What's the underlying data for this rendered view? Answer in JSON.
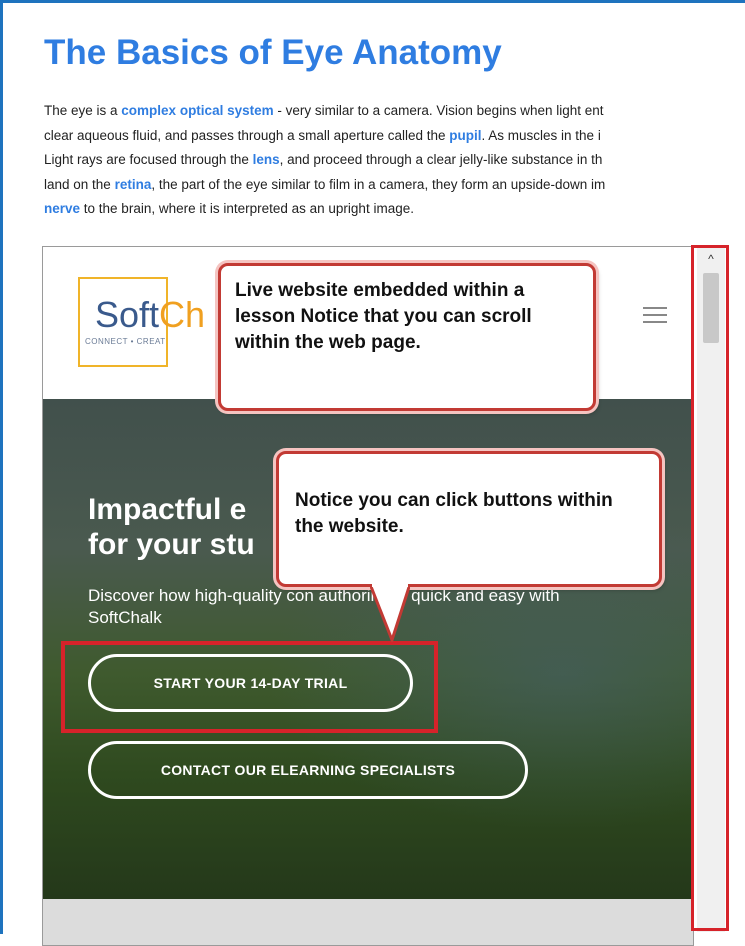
{
  "lesson": {
    "title": "The Basics of Eye Anatomy",
    "para_lines": [
      [
        {
          "t": "The eye is a "
        },
        {
          "t": "complex optical system",
          "kw": true
        },
        {
          "t": " - very similar to a camera. Vision begins when light ent"
        }
      ],
      [
        {
          "t": "clear aqueous fluid, and passes through a small aperture called the "
        },
        {
          "t": "pupil",
          "kw": true
        },
        {
          "t": ". As muscles in the i"
        }
      ],
      [
        {
          "t": "Light rays are focused through the "
        },
        {
          "t": "lens",
          "kw": true
        },
        {
          "t": ", and proceed through a clear jelly-like substance in th"
        }
      ],
      [
        {
          "t": "land on the "
        },
        {
          "t": "retina",
          "kw": true
        },
        {
          "t": ", the part of the eye similar to film in a camera, they form an upside-down im"
        }
      ],
      [
        {
          "t": "nerve",
          "kw": true
        },
        {
          "t": " to the brain, where it is interpreted as an upright image."
        }
      ]
    ]
  },
  "site": {
    "logo_soft": "Soft",
    "logo_chalk": "Ch",
    "logo_tagline": "CONNECT • CREAT",
    "hero_heading": "Impactful e\nfor your stu",
    "hero_sub": "Discover how high-quality con   authoring is quick and easy with SoftChalk",
    "btn_trial": "START YOUR 14-DAY TRIAL",
    "btn_contact": "CONTACT OUR ELEARNING SPECIALISTS"
  },
  "scrollbar": {
    "up_arrow": "^"
  },
  "callouts": {
    "c1": "Live website embedded within a lesson Notice that you can scroll within the web page.",
    "c2": "Notice you can click buttons within the website."
  },
  "colors": {
    "title_blue": "#2f7de1",
    "frame_blue": "#1e73be",
    "highlight_red": "#d6232a",
    "logo_gold": "#f0b429"
  }
}
